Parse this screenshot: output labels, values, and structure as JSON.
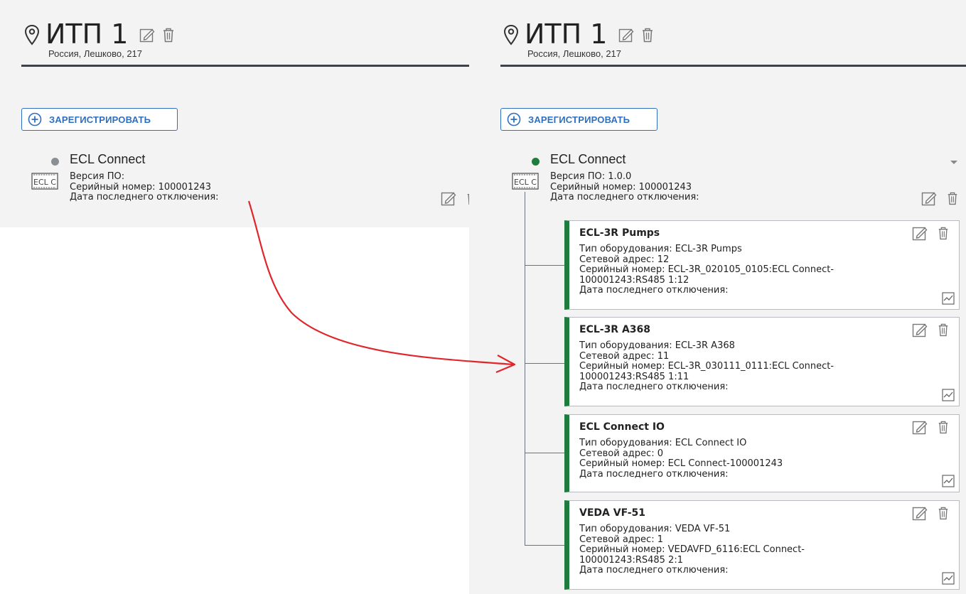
{
  "colors": {
    "accent_blue": "#2f6fbe",
    "status_grey": "#8a8f96",
    "status_green": "#1e7d3c",
    "card_border_green": "#1e7d3c",
    "arrow_red": "#e0262b",
    "rule_dark": "#3a4250"
  },
  "left_panel": {
    "title": "ИТП 1",
    "address": "Россия, Лешково, 217",
    "register_label": "ЗАРЕГИСТРИРОВАТЬ",
    "device": {
      "name": "ECL Connect",
      "status": "offline",
      "icon": "ecl-connect-icon",
      "icon_text": "ECL C",
      "firmware": "Версия ПО:",
      "serial": "Серийный номер: 100001243",
      "last_disconnect": "Дата последнего отключения:"
    }
  },
  "right_panel": {
    "title": "ИТП 1",
    "address": "Россия, Лешково, 217",
    "register_label": "ЗАРЕГИСТРИРОВАТЬ",
    "device": {
      "name": "ECL Connect",
      "status": "online",
      "icon": "ecl-connect-icon",
      "icon_text": "ECL C",
      "firmware": "Версия ПО: 1.0.0",
      "serial": "Серийный номер: 100001243",
      "last_disconnect": "Дата последнего отключения:"
    },
    "children": [
      {
        "name": "ECL-3R Pumps",
        "body": "Тип оборудования: ECL-3R Pumps\nСетевой адрес: 12\nСерийный номер: ECL-3R_020105_0105:ECL Connect-\n100001243:RS485 1:12\nДата последнего отключения:"
      },
      {
        "name": "ECL-3R A368",
        "body": "Тип оборудования: ECL-3R A368\nСетевой адрес: 11\nСерийный номер: ECL-3R_030111_0111:ECL Connect-\n100001243:RS485 1:11\nДата последнего отключения:"
      },
      {
        "name": "ECL Connect IO",
        "body": "Тип оборудования: ECL Connect IO\nСетевой адрес: 0\nСерийный номер: ECL Connect-100001243\nДата последнего отключения:"
      },
      {
        "name": "VEDA VF-51",
        "body": "Тип оборудования: VEDA VF-51\nСетевой адрес: 1\nСерийный номер: VEDAVFD_6116:ECL Connect-\n100001243:RS485 2:1\nДата последнего отключения:"
      }
    ]
  }
}
